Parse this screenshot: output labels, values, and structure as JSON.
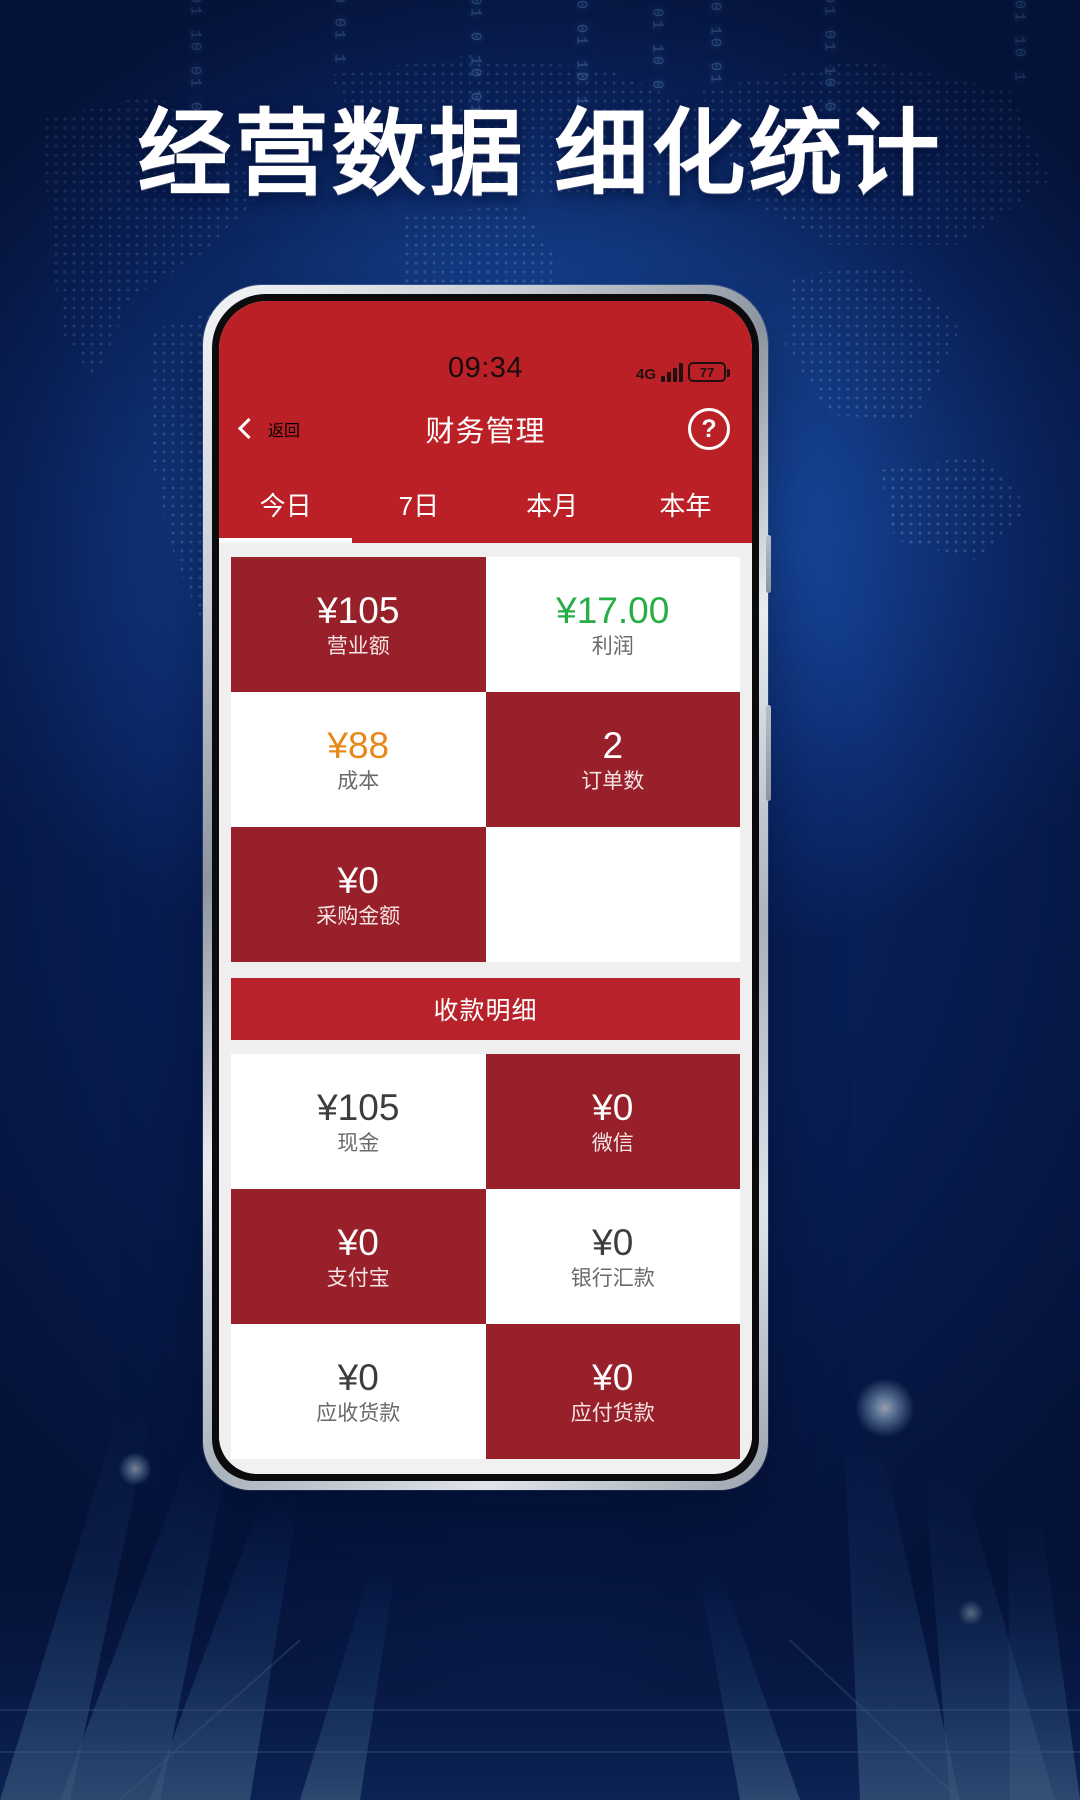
{
  "headline": "经营数据 细化统计",
  "phone": {
    "statusbar": {
      "time": "09:34",
      "network": "4G",
      "battery_level": "77"
    },
    "navbar": {
      "back_label": "返回",
      "title": "财务管理",
      "help_icon": "?"
    },
    "tabs": [
      {
        "label": "今日",
        "active": true
      },
      {
        "label": "7日",
        "active": false
      },
      {
        "label": "本月",
        "active": false
      },
      {
        "label": "本年",
        "active": false
      }
    ],
    "summary_cells": [
      {
        "value": "¥105",
        "label": "营业额",
        "style": "red"
      },
      {
        "value": "¥17.00",
        "label": "利润",
        "style": "white-green"
      },
      {
        "value": "¥88",
        "label": "成本",
        "style": "white-orange"
      },
      {
        "value": "2",
        "label": "订单数",
        "style": "red"
      },
      {
        "value": "¥0",
        "label": "采购金额",
        "style": "red"
      },
      {
        "value": "",
        "label": "",
        "style": "blank"
      }
    ],
    "section_title": "收款明细",
    "payment_cells": [
      {
        "value": "¥105",
        "label": "现金",
        "style": "white"
      },
      {
        "value": "¥0",
        "label": "微信",
        "style": "red"
      },
      {
        "value": "¥0",
        "label": "支付宝",
        "style": "red"
      },
      {
        "value": "¥0",
        "label": "银行汇款",
        "style": "white"
      },
      {
        "value": "¥0",
        "label": "应收货款",
        "style": "white"
      },
      {
        "value": "¥0",
        "label": "应付货款",
        "style": "red"
      }
    ]
  },
  "colors": {
    "brand_red": "#bb2026",
    "card_red": "#97202a",
    "section_red": "#b8232b",
    "profit_green": "#27ad45",
    "cost_orange": "#e8881b",
    "bg_blue": "#113f96"
  }
}
